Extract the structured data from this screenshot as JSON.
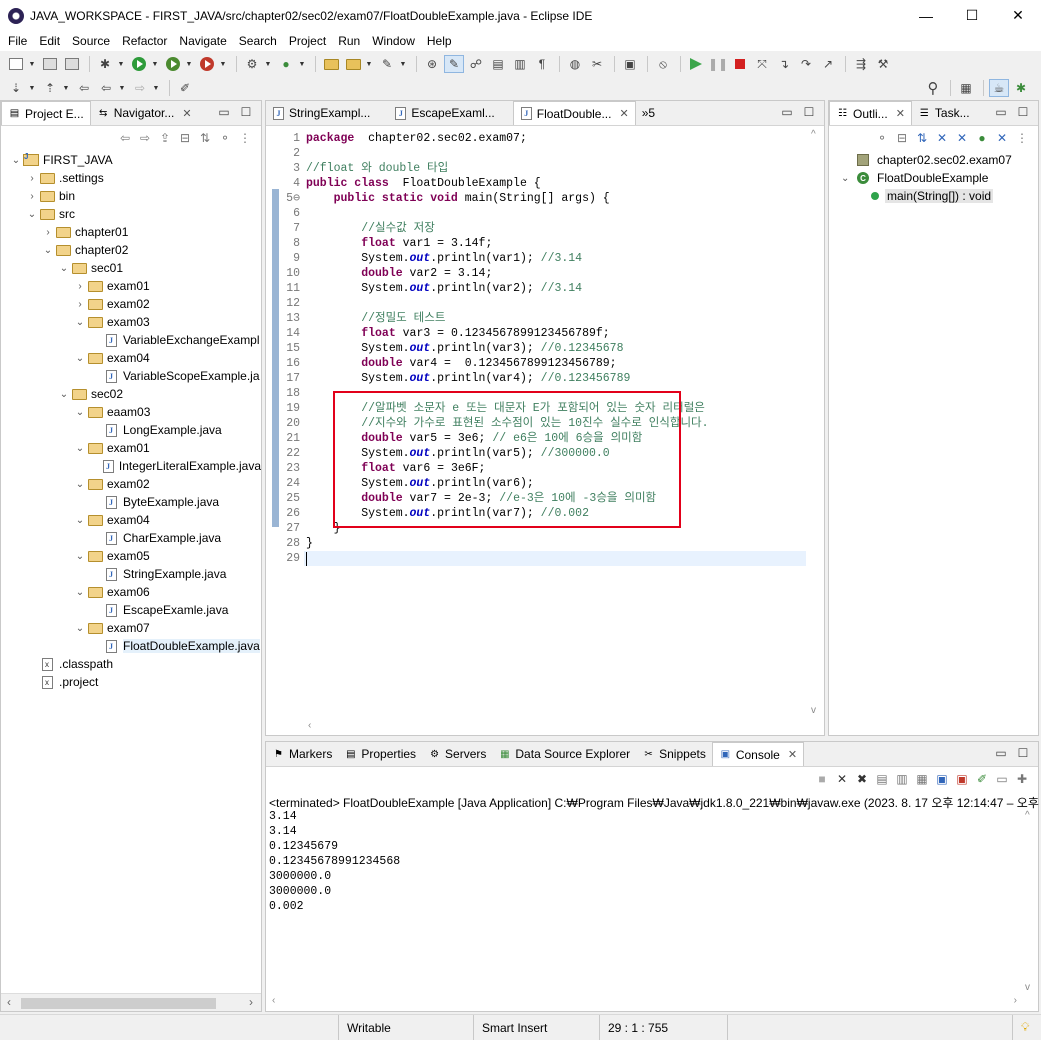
{
  "window": {
    "title": "JAVA_WORKSPACE - FIRST_JAVA/src/chapter02/sec02/exam07/FloatDoubleExample.java - Eclipse IDE",
    "minimize": "—",
    "maximize": "☐",
    "close": "✕"
  },
  "menu": [
    "File",
    "Edit",
    "Source",
    "Refactor",
    "Navigate",
    "Search",
    "Project",
    "Run",
    "Window",
    "Help"
  ],
  "left_panel": {
    "tabs": [
      {
        "label": "Project E...",
        "active": true
      },
      {
        "label": "Navigator...",
        "active": false
      }
    ],
    "tree": [
      {
        "label": "FIRST_JAVA",
        "depth": 0,
        "twisty": "open",
        "icon": "project"
      },
      {
        "label": ".settings",
        "depth": 1,
        "twisty": "closed",
        "icon": "folder"
      },
      {
        "label": "bin",
        "depth": 1,
        "twisty": "closed",
        "icon": "folder"
      },
      {
        "label": "src",
        "depth": 1,
        "twisty": "open",
        "icon": "folder"
      },
      {
        "label": "chapter01",
        "depth": 2,
        "twisty": "closed",
        "icon": "folder"
      },
      {
        "label": "chapter02",
        "depth": 2,
        "twisty": "open",
        "icon": "folder"
      },
      {
        "label": "sec01",
        "depth": 3,
        "twisty": "open",
        "icon": "folder"
      },
      {
        "label": "exam01",
        "depth": 4,
        "twisty": "closed",
        "icon": "folder"
      },
      {
        "label": "exam02",
        "depth": 4,
        "twisty": "closed",
        "icon": "folder"
      },
      {
        "label": "exam03",
        "depth": 4,
        "twisty": "open",
        "icon": "folder"
      },
      {
        "label": "VariableExchangeExampl",
        "depth": 5,
        "twisty": "none",
        "icon": "java"
      },
      {
        "label": "exam04",
        "depth": 4,
        "twisty": "open",
        "icon": "folder"
      },
      {
        "label": "VariableScopeExample.ja",
        "depth": 5,
        "twisty": "none",
        "icon": "java"
      },
      {
        "label": "sec02",
        "depth": 3,
        "twisty": "open",
        "icon": "folder"
      },
      {
        "label": "eaam03",
        "depth": 4,
        "twisty": "open",
        "icon": "folder"
      },
      {
        "label": "LongExample.java",
        "depth": 5,
        "twisty": "none",
        "icon": "java"
      },
      {
        "label": "exam01",
        "depth": 4,
        "twisty": "open",
        "icon": "folder"
      },
      {
        "label": "IntegerLiteralExample.java",
        "depth": 5,
        "twisty": "none",
        "icon": "java"
      },
      {
        "label": "exam02",
        "depth": 4,
        "twisty": "open",
        "icon": "folder"
      },
      {
        "label": "ByteExample.java",
        "depth": 5,
        "twisty": "none",
        "icon": "java"
      },
      {
        "label": "exam04",
        "depth": 4,
        "twisty": "open",
        "icon": "folder"
      },
      {
        "label": "CharExample.java",
        "depth": 5,
        "twisty": "none",
        "icon": "java"
      },
      {
        "label": "exam05",
        "depth": 4,
        "twisty": "open",
        "icon": "folder"
      },
      {
        "label": "StringExample.java",
        "depth": 5,
        "twisty": "none",
        "icon": "java"
      },
      {
        "label": "exam06",
        "depth": 4,
        "twisty": "open",
        "icon": "folder"
      },
      {
        "label": "EscapeExamle.java",
        "depth": 5,
        "twisty": "none",
        "icon": "java"
      },
      {
        "label": "exam07",
        "depth": 4,
        "twisty": "open",
        "icon": "folder"
      },
      {
        "label": "FloatDoubleExample.java",
        "depth": 5,
        "twisty": "none",
        "icon": "java",
        "selected": true
      },
      {
        "label": ".classpath",
        "depth": 1,
        "twisty": "none",
        "icon": "xml"
      },
      {
        "label": ".project",
        "depth": 1,
        "twisty": "none",
        "icon": "xml"
      }
    ]
  },
  "editor": {
    "tabs": [
      {
        "label": "StringExampl...",
        "active": false
      },
      {
        "label": "EscapeExaml...",
        "active": false
      },
      {
        "label": "FloatDouble...",
        "active": true
      }
    ],
    "overflow_label": "»5",
    "lines": [
      [
        [
          "kw",
          "package"
        ],
        [
          "",
          "  chapter02.sec02.exam07;"
        ]
      ],
      [],
      [
        [
          "cm",
          "//float 와 double 타입"
        ]
      ],
      [
        [
          "kw",
          "public class"
        ],
        [
          "",
          "  FloatDoubleExample {"
        ]
      ],
      [
        [
          "",
          "    "
        ],
        [
          "kw",
          "public static void"
        ],
        [
          "",
          " main(String[] args) {"
        ]
      ],
      [],
      [
        [
          "",
          "        "
        ],
        [
          "cm",
          "//실수값 저장"
        ]
      ],
      [
        [
          "",
          "        "
        ],
        [
          "kw",
          "float"
        ],
        [
          "",
          " var1 = 3.14f;"
        ]
      ],
      [
        [
          "",
          "        System."
        ],
        [
          "fi",
          "out"
        ],
        [
          "",
          ".println(var1); "
        ],
        [
          "cm",
          "//3.14"
        ]
      ],
      [
        [
          "",
          "        "
        ],
        [
          "kw",
          "double"
        ],
        [
          "",
          " var2 = 3.14;"
        ]
      ],
      [
        [
          "",
          "        System."
        ],
        [
          "fi",
          "out"
        ],
        [
          "",
          ".println(var2); "
        ],
        [
          "cm",
          "//3.14"
        ]
      ],
      [],
      [
        [
          "",
          "        "
        ],
        [
          "cm",
          "//정밀도 테스트"
        ]
      ],
      [
        [
          "",
          "        "
        ],
        [
          "kw",
          "float"
        ],
        [
          "",
          " var3 = 0.1234567899123456789f;"
        ]
      ],
      [
        [
          "",
          "        System."
        ],
        [
          "fi",
          "out"
        ],
        [
          "",
          ".println(var3); "
        ],
        [
          "cm",
          "//0.12345678"
        ]
      ],
      [
        [
          "",
          "        "
        ],
        [
          "kw",
          "double"
        ],
        [
          "",
          " var4 =  0.1234567899123456789;"
        ]
      ],
      [
        [
          "",
          "        System."
        ],
        [
          "fi",
          "out"
        ],
        [
          "",
          ".println(var4); "
        ],
        [
          "cm",
          "//0.123456789"
        ]
      ],
      [],
      [
        [
          "",
          "        "
        ],
        [
          "cm",
          "//알파벳 소문자 e 또는 대문자 E가 포함되어 있는 숫자 리터럴은"
        ]
      ],
      [
        [
          "",
          "        "
        ],
        [
          "cm",
          "//지수와 가수로 표현된 소수점이 있는 10진수 실수로 인식합니다."
        ]
      ],
      [
        [
          "",
          "        "
        ],
        [
          "kw",
          "double"
        ],
        [
          "",
          " var5 = 3e6; "
        ],
        [
          "cm",
          "// e6은 10에 6승을 의미함"
        ]
      ],
      [
        [
          "",
          "        System."
        ],
        [
          "fi",
          "out"
        ],
        [
          "",
          ".println(var5); "
        ],
        [
          "cm",
          "//300000.0"
        ]
      ],
      [
        [
          "",
          "        "
        ],
        [
          "kw",
          "float"
        ],
        [
          "",
          " var6 = 3e6F;"
        ]
      ],
      [
        [
          "",
          "        System."
        ],
        [
          "fi",
          "out"
        ],
        [
          "",
          ".println(var6);"
        ]
      ],
      [
        [
          "",
          "        "
        ],
        [
          "kw",
          "double"
        ],
        [
          "",
          " var7 = 2e-3; "
        ],
        [
          "cm",
          "//e-3은 10에 -3승을 의미함"
        ]
      ],
      [
        [
          "",
          "        System."
        ],
        [
          "fi",
          "out"
        ],
        [
          "",
          ".println(var7); "
        ],
        [
          "cm",
          "//0.002"
        ]
      ],
      [
        [
          "",
          "    }"
        ]
      ],
      [
        [
          "",
          "}"
        ]
      ],
      []
    ]
  },
  "outline": {
    "tabs": [
      {
        "label": "Outli...",
        "active": true
      },
      {
        "label": "Task...",
        "active": false
      }
    ],
    "items": [
      {
        "label": "chapter02.sec02.exam07",
        "kind": "package"
      },
      {
        "label": "FloatDoubleExample",
        "kind": "class"
      },
      {
        "label": "main(String[]) : void",
        "kind": "method"
      }
    ]
  },
  "bottom_panel": {
    "tabs": [
      {
        "label": "Markers",
        "active": false
      },
      {
        "label": "Properties",
        "active": false
      },
      {
        "label": "Servers",
        "active": false
      },
      {
        "label": "Data Source Explorer",
        "active": false
      },
      {
        "label": "Snippets",
        "active": false
      },
      {
        "label": "Console",
        "active": true
      }
    ],
    "status": "<terminated> FloatDoubleExample [Java Application] C:₩Program Files₩Java₩jdk1.8.0_221₩bin₩javaw.exe  (2023. 8. 17 오후 12:14:47 – 오후",
    "output": [
      "3.14",
      "3.14",
      "0.12345679",
      "0.123456789912345​68",
      "3000000.0",
      "3000000.0",
      "0.002"
    ]
  },
  "statusbar": {
    "writable": "Writable",
    "insert_mode": "Smart Insert",
    "position": "29 : 1 : 755"
  },
  "colors": {
    "keyword": "#7f0055",
    "comment": "#3f7f5f",
    "field": "#0000c0",
    "highlight_box": "#e2001a"
  }
}
